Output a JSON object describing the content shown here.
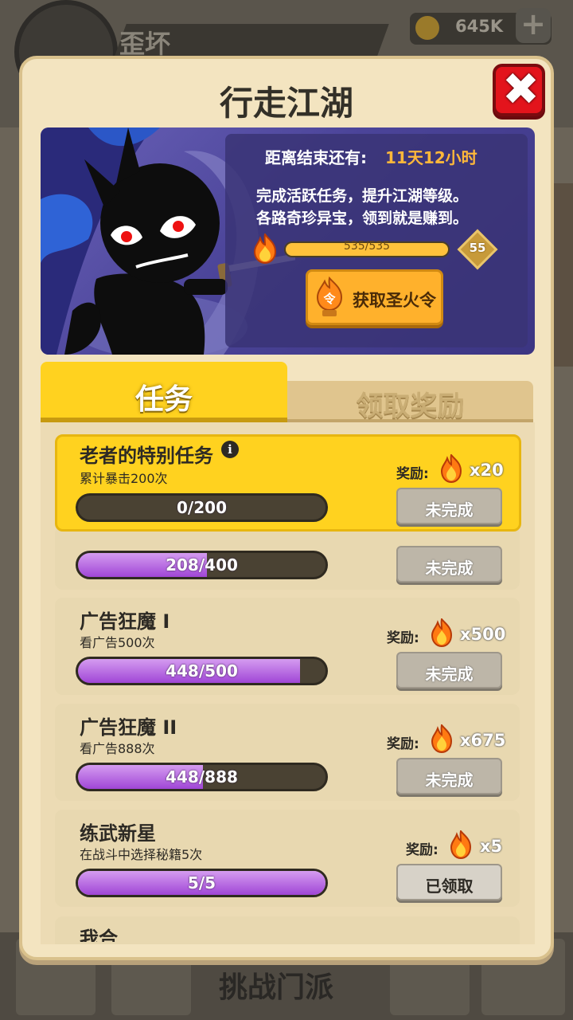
{
  "background": {
    "player_name": "歪坏",
    "coins": "645K",
    "add_label": "+",
    "bottom_nav_label": "挑战门派"
  },
  "dialog": {
    "title": "行走江湖",
    "close_icon": "close-icon",
    "banner": {
      "countdown_label": "距离结束还有:",
      "countdown_value": "11天12小时",
      "desc_line1": "完成活跃任务，提升江湖等级。",
      "desc_line2": "各路奇珍异宝，领到就是赚到。",
      "level_progress_text": "535/535",
      "level_progress_fraction": 1.0,
      "level": "55",
      "get_token_button": "获取圣火令",
      "token_icon_char": "令"
    },
    "tabs": [
      {
        "label": "任务",
        "active": true
      },
      {
        "label": "领取奖励",
        "active": false
      }
    ],
    "reward_prefix": "奖励:",
    "tasks": [
      {
        "title": "老者的特别任务",
        "subtitle": "累计暴击200次",
        "progress_text": "0/200",
        "fraction": 0.0,
        "reward": "x20",
        "status": "未完成",
        "highlight": true
      },
      {
        "title": "",
        "subtitle": "",
        "progress_text": "208/400",
        "fraction": 0.52,
        "reward": "",
        "status": "未完成",
        "highlight": false
      },
      {
        "title": "广告狂魔 I",
        "subtitle": "看广告500次",
        "progress_text": "448/500",
        "fraction": 0.896,
        "reward": "x500",
        "status": "未完成",
        "highlight": false
      },
      {
        "title": "广告狂魔 II",
        "subtitle": "看广告888次",
        "progress_text": "448/888",
        "fraction": 0.504,
        "reward": "x675",
        "status": "未完成",
        "highlight": false
      },
      {
        "title": "练武新星",
        "subtitle": "在战斗中选择秘籍5次",
        "progress_text": "5/5",
        "fraction": 1.0,
        "reward": "x5",
        "status": "已领取",
        "highlight": false
      },
      {
        "title": "我合",
        "subtitle": "",
        "progress_text": "",
        "fraction": 0.0,
        "reward": "",
        "status": "",
        "highlight": false
      }
    ]
  },
  "colors": {
    "dialog_bg": "#f3e4c0",
    "accent_yellow": "#ffd21f",
    "close_red": "#e3141c",
    "progress_purple": "#a046d6",
    "countdown_orange": "#ffb83a"
  }
}
